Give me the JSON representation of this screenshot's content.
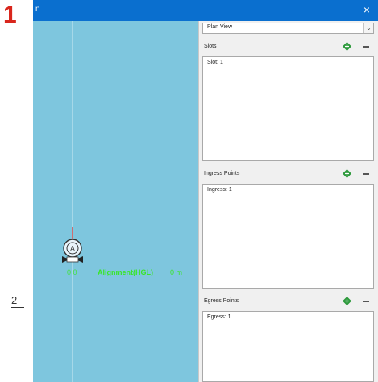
{
  "annotations": {
    "step_number": "1",
    "side_marker": "2"
  },
  "window": {
    "title": "n",
    "close_glyph": "×"
  },
  "canvas": {
    "background_color": "#7ec6de",
    "robot_label": "A",
    "origin_label": "0  0",
    "alignment_label": "Alignment(HGL)",
    "distance_label": "0 m"
  },
  "panel": {
    "view_select": {
      "value": "Plan View",
      "chevron_glyph": "⌄"
    },
    "sections": {
      "slots": {
        "label": "Slots",
        "items": [
          "Slot: 1"
        ]
      },
      "ingress": {
        "label": "Ingress Points",
        "items": [
          "Ingress: 1"
        ]
      },
      "egress": {
        "label": "Egress Points",
        "items": [
          "Egress: 1"
        ]
      }
    },
    "icons": {
      "add": "add-diamond-icon",
      "remove": "minus-icon"
    },
    "colors": {
      "add_icon": "#2e9a3d",
      "titlebar": "#0a6fcf",
      "label_green": "#39e629"
    }
  }
}
